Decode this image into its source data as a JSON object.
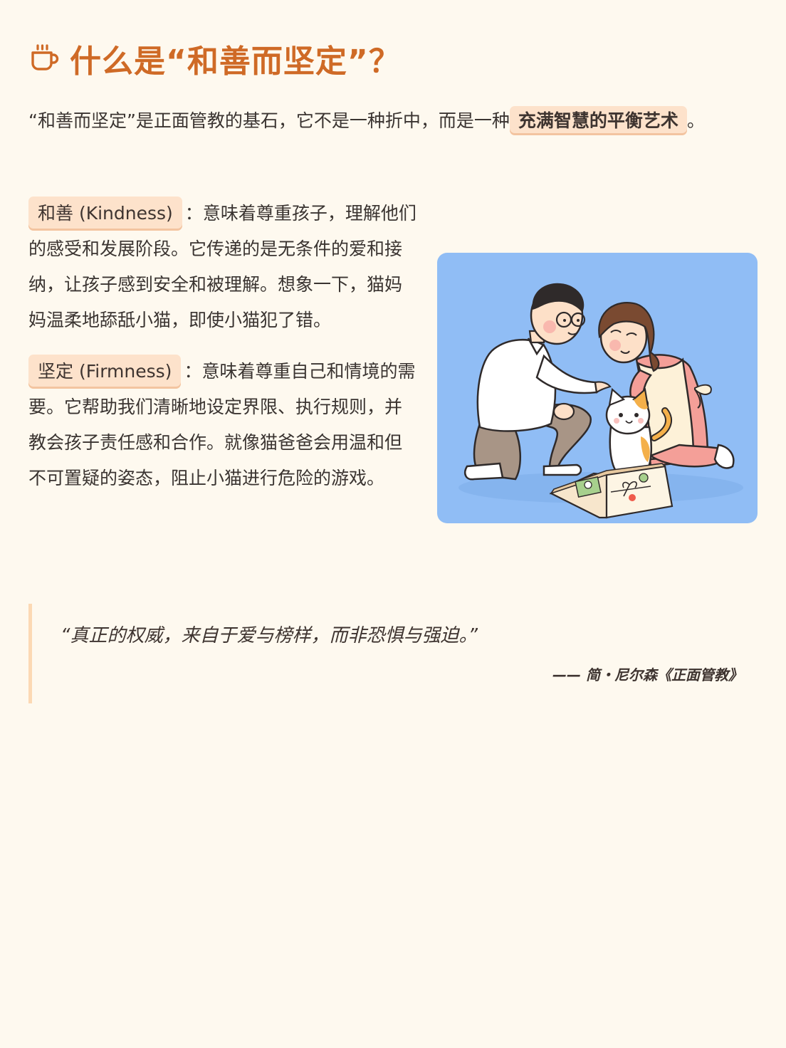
{
  "header": {
    "title": "什么是“和善而坚定”？",
    "icon": "coffee-cup-icon",
    "accent_color": "#cf6a26"
  },
  "intro": {
    "text": "“和善而坚定”是正面管教的基石，它不是一种折中，而是一种",
    "highlight": "充满智慧的平衡艺术",
    "end": "。"
  },
  "kindness": {
    "tag": "和善 (Kindness)",
    "colon": "：",
    "text": "意味着尊重孩子，理解他们的感受和发展阶段。它传递的是无条件的爱和接纳，让孩子感到安全和被理解。想象一下，猫妈妈温柔地舔舐小猫，即使小猫犯了错。"
  },
  "firmness": {
    "tag": "坚定 (Firmness)",
    "colon": "：",
    "text": "意味着尊重自己和情境的需要。它帮助我们清晰地设定界限、执行规则，并教会孩子责任感和合作。就像猫爸爸会用温和但不可置疑的姿态，阻止小猫进行危险的游戏。"
  },
  "illustration": {
    "background_color": "#90bdf5"
  },
  "quote": {
    "text": "“真正的权威，来自于爱与榜样，而非恐惧与强迫。”",
    "source": "—— 简・尼尔森《正面管教》"
  }
}
